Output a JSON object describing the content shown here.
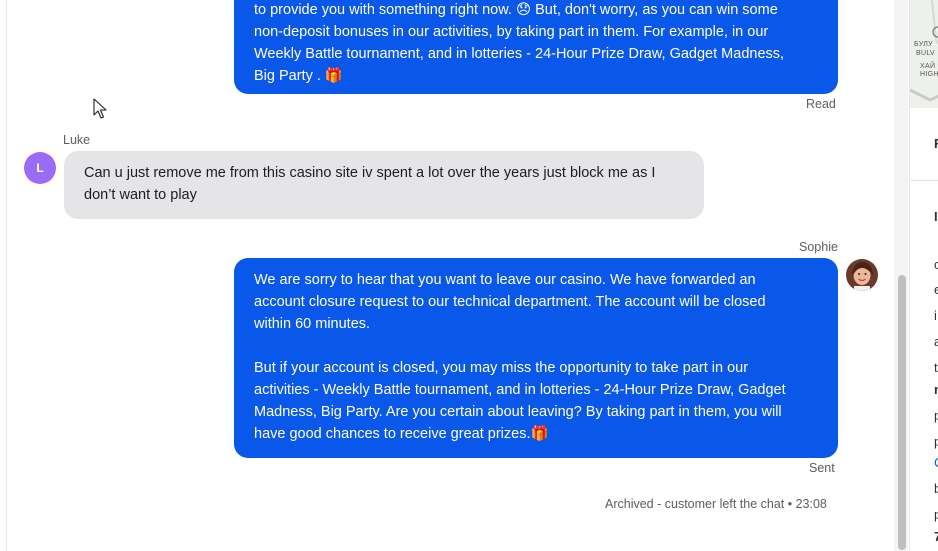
{
  "messages": {
    "agent_top": {
      "lines": [
        "to provide you with something right now. 😞 But, don't worry, as you can win some",
        "non-deposit bonuses in our activities, by taking part in them. For example, in our",
        "Weekly Battle tournament, and in lotteries - 24-Hour Prize Draw, Gadget Madness,",
        "Big Party . 🎁"
      ],
      "status": "Read"
    },
    "customer": {
      "author": "Luke",
      "avatar_letter": "L",
      "lines": [
        "Can u just remove me from this casino site iv spent a lot over the years just block me as I",
        "don’t want to play"
      ]
    },
    "agent_reply": {
      "author": "Sophie",
      "para1": [
        "We are sorry to hear that you want to leave our casino. We have forwarded an",
        "account closure request to our technical department. The account will be closed",
        "within 60 minutes."
      ],
      "para2": [
        "But if your account is closed, you may miss the opportunity to take part in our",
        "activities - Weekly Battle tournament, and in lotteries - 24-Hour Prize Draw, Gadget",
        "Madness, Big Party. Are you certain about leaving? By taking part in them, you will",
        "have good chances to receive great prizes.🎁"
      ],
      "status": "Sent"
    },
    "archived": "Archived - customer left the chat • 23:08"
  },
  "side_panel": {
    "map_labels": [
      "БУЛУ",
      "BULV",
      "ХАЙ",
      "HIGH"
    ],
    "letters": [
      "F",
      "I",
      "c",
      "e",
      "i",
      "a",
      "t",
      "r",
      "p",
      "p",
      "C",
      "b",
      "p",
      "7"
    ]
  },
  "colors": {
    "agent_bubble": "#0a58ea",
    "customer_bubble": "#e5e5e7",
    "customer_avatar": "#9b6cf3"
  },
  "icons": {
    "cursor": "mouse-pointer-icon",
    "agent_avatar": "agent-avatar-photo"
  }
}
